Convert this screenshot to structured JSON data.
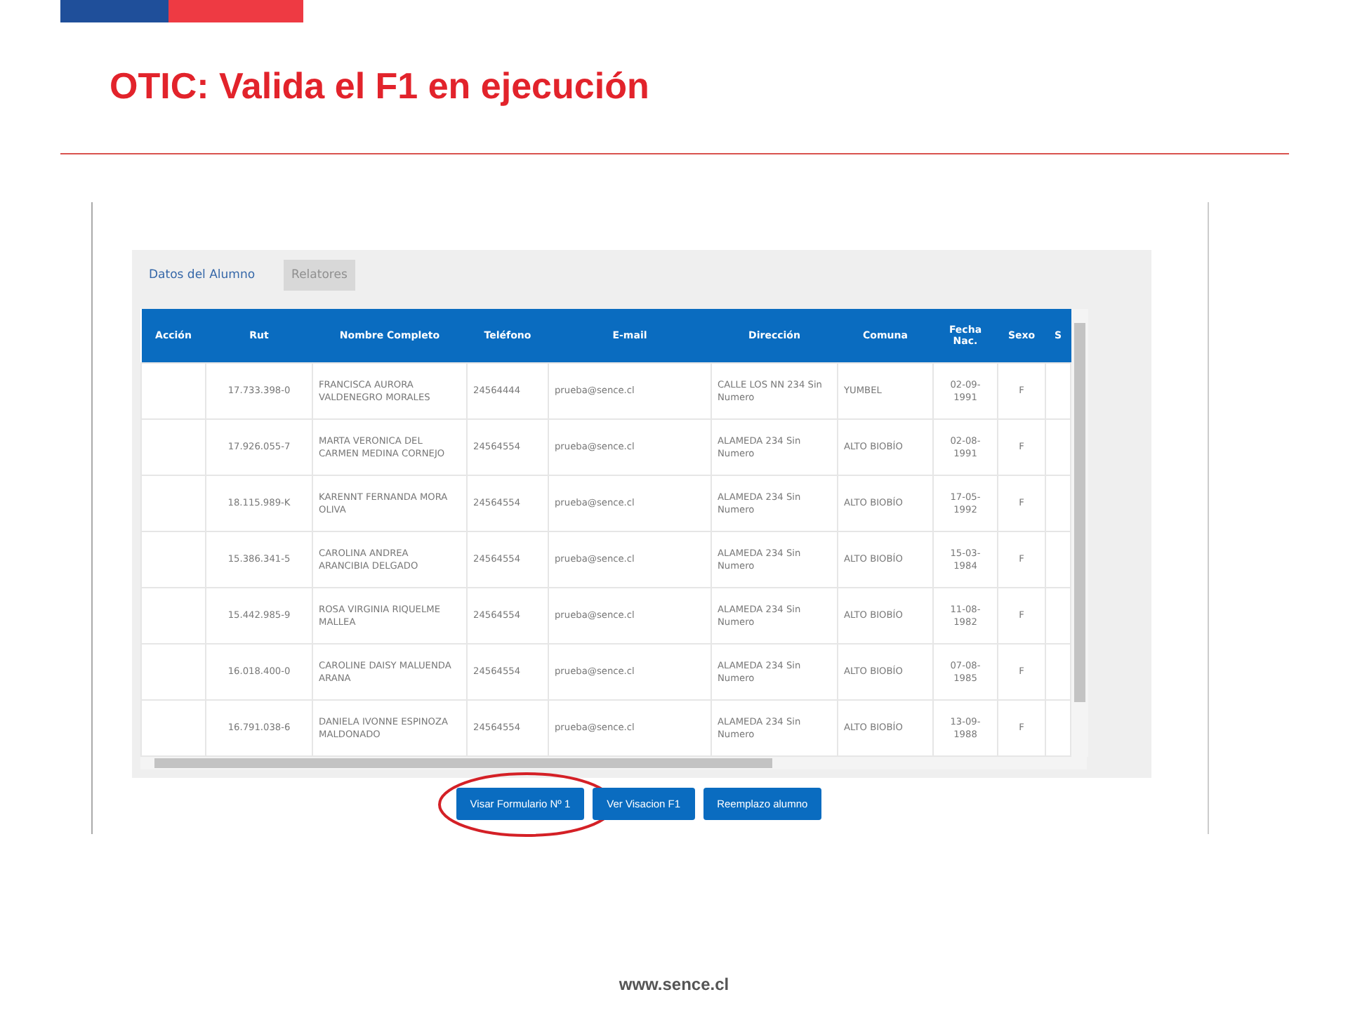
{
  "slide": {
    "title": "OTIC: Valida el F1 en ejecución",
    "footer": "www.sence.cl"
  },
  "tabs": [
    {
      "label": "Datos del Alumno",
      "selected": true,
      "disabled": false
    },
    {
      "label": "Relatores",
      "selected": false,
      "disabled": true
    }
  ],
  "table": {
    "columns": [
      "Acción",
      "Rut",
      "Nombre Completo",
      "Teléfono",
      "E-mail",
      "Dirección",
      "Comuna",
      "Fecha Nac.",
      "Sexo",
      "S"
    ],
    "rows": [
      {
        "rut": "17.733.398-0",
        "nombre": "FRANCISCA AURORA VALDENEGRO MORALES",
        "telefono": "24564444",
        "email": "prueba@sence.cl",
        "direccion": "CALLE LOS NN 234 Sin Numero",
        "comuna": "YUMBEL",
        "fecha": "02-09-1991",
        "sexo": "F"
      },
      {
        "rut": "17.926.055-7",
        "nombre": "MARTA VERONICA DEL CARMEN MEDINA CORNEJO",
        "telefono": "24564554",
        "email": "prueba@sence.cl",
        "direccion": "ALAMEDA 234 Sin Numero",
        "comuna": "ALTO BIOBÍO",
        "fecha": "02-08-1991",
        "sexo": "F"
      },
      {
        "rut": "18.115.989-K",
        "nombre": "KARENNT FERNANDA MORA OLIVA",
        "telefono": "24564554",
        "email": "prueba@sence.cl",
        "direccion": "ALAMEDA 234 Sin Numero",
        "comuna": "ALTO BIOBÍO",
        "fecha": "17-05-1992",
        "sexo": "F"
      },
      {
        "rut": "15.386.341-5",
        "nombre": "CAROLINA ANDREA ARANCIBIA DELGADO",
        "telefono": "24564554",
        "email": "prueba@sence.cl",
        "direccion": "ALAMEDA 234 Sin Numero",
        "comuna": "ALTO BIOBÍO",
        "fecha": "15-03-1984",
        "sexo": "F"
      },
      {
        "rut": "15.442.985-9",
        "nombre": "ROSA VIRGINIA RIQUELME MALLEA",
        "telefono": "24564554",
        "email": "prueba@sence.cl",
        "direccion": "ALAMEDA 234 Sin Numero",
        "comuna": "ALTO BIOBÍO",
        "fecha": "11-08-1982",
        "sexo": "F"
      },
      {
        "rut": "16.018.400-0",
        "nombre": "CAROLINE DAISY MALUENDA ARANA",
        "telefono": "24564554",
        "email": "prueba@sence.cl",
        "direccion": "ALAMEDA 234 Sin Numero",
        "comuna": "ALTO BIOBÍO",
        "fecha": "07-08-1985",
        "sexo": "F"
      },
      {
        "rut": "16.791.038-6",
        "nombre": "DANIELA IVONNE ESPINOZA MALDONADO",
        "telefono": "24564554",
        "email": "prueba@sence.cl",
        "direccion": "ALAMEDA 234 Sin Numero",
        "comuna": "ALTO BIOBÍO",
        "fecha": "13-09-1988",
        "sexo": "F"
      }
    ]
  },
  "buttons": [
    {
      "label": "Visar Formulario Nº 1",
      "highlighted": true
    },
    {
      "label": "Ver Visacion F1",
      "highlighted": false
    },
    {
      "label": "Reemplazo alumno",
      "highlighted": false
    }
  ]
}
